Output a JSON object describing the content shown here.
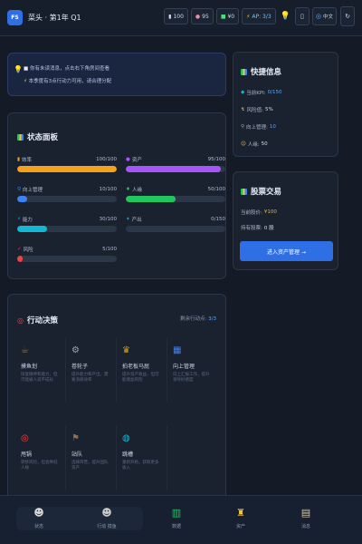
{
  "header": {
    "logo": "FS",
    "title": "菜头 · 第1年 Q1",
    "stats": [
      {
        "icon": "key-icon",
        "glyph": "▮",
        "value": "100"
      },
      {
        "icon": "brain-icon",
        "glyph": "●",
        "value": "95"
      },
      {
        "icon": "cash-icon",
        "glyph": "■",
        "value": "¥0"
      },
      {
        "icon": "bolt-icon",
        "glyph": "⚡",
        "value": "AP: 3/3"
      }
    ],
    "clipboard_glyph": "▯",
    "language_label": "中文",
    "language_glyph": "◎",
    "refresh_glyph": "↻"
  },
  "hint": {
    "line1": "你有未读消息，点击右下角房间查看",
    "line2": "本季度有3点行动力可用，请合理分配"
  },
  "status": {
    "title": "状态面板",
    "bars": [
      {
        "label": "效率",
        "glyph": "▮",
        "value": "100/100",
        "pct": 100,
        "color": "#f5a11a"
      },
      {
        "label": "资产",
        "glyph": "●",
        "value": "95/100",
        "pct": 95,
        "color": "#a855f7"
      },
      {
        "label": "向上管理",
        "glyph": "⚲",
        "value": "10/100",
        "pct": 10,
        "color": "#3b82f6"
      },
      {
        "label": "人缘",
        "glyph": "♦",
        "value": "50/100",
        "pct": 50,
        "color": "#22c55e"
      },
      {
        "label": "能力",
        "glyph": "⚡",
        "value": "30/100",
        "pct": 30,
        "color": "#14b8d4"
      },
      {
        "label": "产出",
        "glyph": "✦",
        "value": "0/150",
        "pct": 0,
        "color": "#06b6d4"
      },
      {
        "label": "风险",
        "glyph": "✓",
        "value": "5/100",
        "pct": 5,
        "color": "#ef4444"
      }
    ]
  },
  "actions": {
    "title": "行动决策",
    "remaining_label": "剩余行动点:",
    "remaining_value": "3/3",
    "items": [
      {
        "name": "摸鱼划",
        "icon": "mug-icon",
        "glyph": "☕",
        "desc": "恢复精神和能力，但可能被人说不成长"
      },
      {
        "name": "卷轮子",
        "icon": "gear-icon",
        "glyph": "⚙",
        "desc": "提升能力和产出，需要消耗效率"
      },
      {
        "name": "拍老板马屁",
        "icon": "crown-icon",
        "glyph": "♛",
        "desc": "提升资产收益，但可能增加风险"
      },
      {
        "name": "向上管理",
        "icon": "chart-icon",
        "glyph": "▦",
        "desc": "向上汇报工作，提升领导好感度"
      },
      {
        "name": "甩锅",
        "icon": "target-icon",
        "glyph": "◎",
        "desc": "转移风险，但会降低人缘"
      },
      {
        "name": "站队",
        "icon": "flag-icon",
        "glyph": "⚑",
        "desc": "选择阵营，提升团队资产"
      },
      {
        "name": "跳槽",
        "icon": "globe-icon",
        "glyph": "◍",
        "desc": "重新开始，获取更多收入"
      }
    ]
  },
  "quick_info": {
    "title": "快捷信息",
    "rows": [
      {
        "glyph": "◆",
        "label": "当前KPI:",
        "value": "0/150",
        "style": "blue"
      },
      {
        "glyph": "↯",
        "label": "风险值:",
        "value": "5%",
        "style": ""
      },
      {
        "glyph": "⚲",
        "label": "向上管理:",
        "value": "10",
        "style": "blue"
      },
      {
        "glyph": "☺",
        "label": "人缘:",
        "value": "50",
        "style": ""
      }
    ]
  },
  "stock": {
    "title": "股票交易",
    "price_label": "当前股价:",
    "price_value": "¥100",
    "holding_label": "持有股票:",
    "holding_value": "0 股",
    "button_label": "进入资产管理 →"
  },
  "nav": [
    {
      "label": "状态",
      "icon": "person-icon",
      "glyph": "☻"
    },
    {
      "label": "行动 摸鱼",
      "icon": "worker-icon",
      "glyph": "☻"
    },
    {
      "label": "数据",
      "icon": "chart-icon",
      "glyph": "▥"
    },
    {
      "label": "资产",
      "icon": "money-bag-icon",
      "glyph": "♜"
    },
    {
      "label": "消息",
      "icon": "scroll-icon",
      "glyph": "▤"
    }
  ]
}
